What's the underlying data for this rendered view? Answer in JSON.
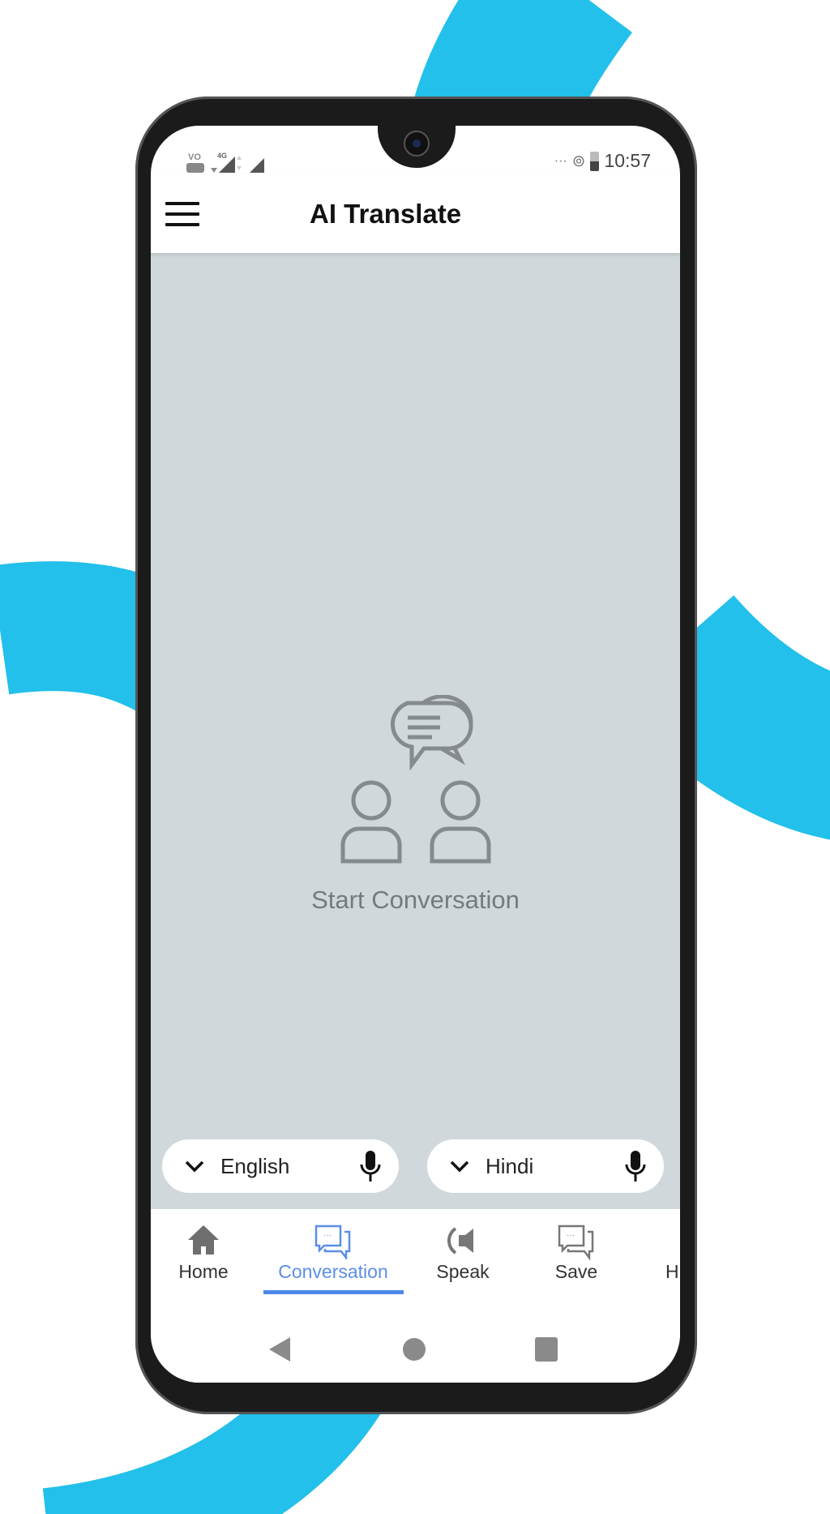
{
  "colors": {
    "accent": "#5b8ee8",
    "swoosh": "#22c0ea",
    "content_bg": "#d0d8db"
  },
  "status_bar": {
    "left_icons": [
      "volte-icon",
      "4g-signal-icon",
      "signal-icon"
    ],
    "right_icons": [
      "more-icon",
      "hotspot-icon",
      "battery-icon"
    ],
    "time": "10:57"
  },
  "header": {
    "menu_icon": "hamburger-icon",
    "title": "AI Translate"
  },
  "empty_state": {
    "icon": "conversation-people-icon",
    "text": "Start Conversation"
  },
  "languages": [
    {
      "label": "English",
      "icon": "mic-icon"
    },
    {
      "label": "Hindi",
      "icon": "mic-icon"
    }
  ],
  "bottom_nav": {
    "active": "Conversation",
    "items": [
      {
        "label": "Home",
        "icon": "home-icon"
      },
      {
        "label": "Conversation",
        "icon": "chat-icon"
      },
      {
        "label": "Speak",
        "icon": "speaker-icon"
      },
      {
        "label": "Save",
        "icon": "chat-icon"
      },
      {
        "label": "H",
        "icon": ""
      }
    ]
  },
  "system_nav": [
    "back-icon",
    "home-circle-icon",
    "recents-icon"
  ]
}
